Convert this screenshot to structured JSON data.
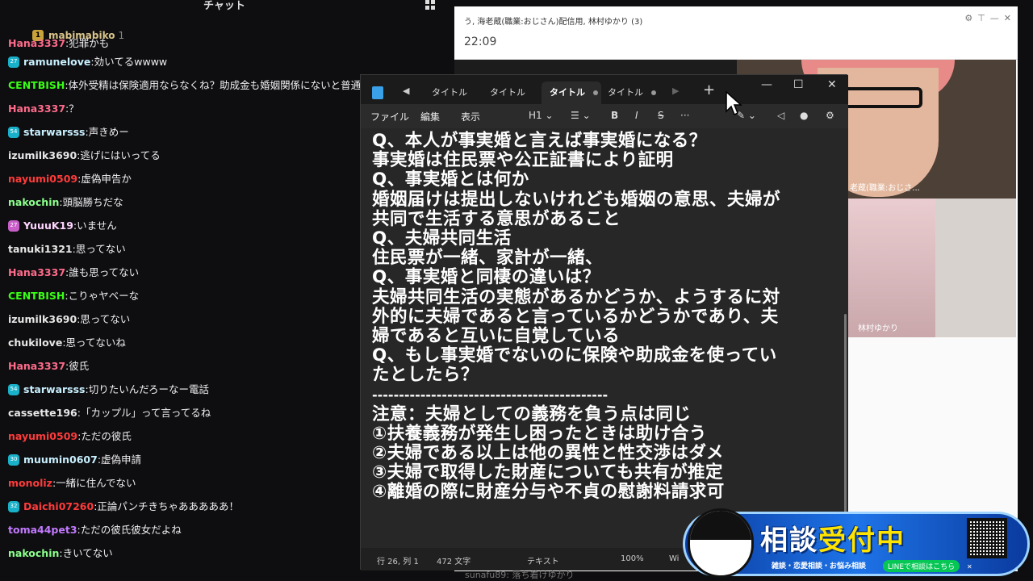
{
  "chat": {
    "title": "チャット",
    "pinned": {
      "badge": "1",
      "name": "mabimabiko",
      "count": "1"
    },
    "messages": [
      {
        "user": "Hana3337",
        "text": "犯罪かも",
        "color": "#ff6b8b",
        "badge": ""
      },
      {
        "user": "ramunelove",
        "text": "効いてるwwww",
        "color": "#c9f0ff",
        "badge": "27",
        "badge_color": "#19b1c9"
      },
      {
        "user": "CENTBISH",
        "text": "体外受精は保険適用ならなくね？助成金も婚姻関係にないと普通",
        "color": "#39ff14",
        "badge": ""
      },
      {
        "user": "Hana3337",
        "text": "？",
        "color": "#ff6b8b",
        "badge": ""
      },
      {
        "user": "starwarsss",
        "text": "声きめー",
        "color": "#c9f0ff",
        "badge": "54",
        "badge_color": "#19b1c9"
      },
      {
        "user": "izumilk3690",
        "text": "逃げにはいってる",
        "color": "#e8e8e8",
        "badge": ""
      },
      {
        "user": "nayumi0509",
        "text": "虚偽申告か",
        "color": "#ff3b3b",
        "badge": ""
      },
      {
        "user": "nakochin",
        "text": "頭脳勝ちだな",
        "color": "#8cff8c",
        "badge": ""
      },
      {
        "user": "YuuuK19",
        "text": "いません",
        "color": "#ffd6ff",
        "badge": "27",
        "badge_color": "#c85fc8"
      },
      {
        "user": "tanuki1321",
        "text": "思ってない",
        "color": "#e8e8e8",
        "badge": ""
      },
      {
        "user": "Hana3337",
        "text": "誰も思ってない",
        "color": "#ff6b8b",
        "badge": ""
      },
      {
        "user": "CENTBISH",
        "text": "こりゃヤベーな",
        "color": "#39ff14",
        "badge": ""
      },
      {
        "user": "izumilk3690",
        "text": "思ってない",
        "color": "#e8e8e8",
        "badge": ""
      },
      {
        "user": "chukilove",
        "text": "思ってないね",
        "color": "#e8e8e8",
        "badge": ""
      },
      {
        "user": "Hana3337",
        "text": "彼氏",
        "color": "#ff6b8b",
        "badge": ""
      },
      {
        "user": "starwarsss",
        "text": "切りたいんだろーなー電話",
        "color": "#c9f0ff",
        "badge": "54",
        "badge_color": "#19b1c9"
      },
      {
        "user": "cassette196",
        "text": "「カップル」って言ってるね",
        "color": "#e8e8e8",
        "badge": ""
      },
      {
        "user": "nayumi0509",
        "text": "ただの彼氏",
        "color": "#ff3b3b",
        "badge": ""
      },
      {
        "user": "muumin0607",
        "text": "虚偽申請",
        "color": "#c9f0ff",
        "badge": "30",
        "badge_color": "#19b1c9"
      },
      {
        "user": "monoliz",
        "text": "一緒に住んでない",
        "color": "#ff3b3b",
        "badge": ""
      },
      {
        "user": "Daichi07260",
        "text": "正論パンチきちゃあああああ！",
        "color": "#ff3b3b",
        "badge": "32",
        "badge_color": "#19b1c9"
      },
      {
        "user": "toma44pet3",
        "text": "ただの彼氏彼女だよね",
        "color": "#c37aff",
        "badge": ""
      },
      {
        "user": "nakochin",
        "text": "きいてない",
        "color": "#8cff8c",
        "badge": ""
      }
    ]
  },
  "call": {
    "title": "う, 海老蔵(職業:おじさん)配信用, 林村ゆかり (3)",
    "time": "22:09",
    "label1": "老蔵(職業:おじさ...",
    "label2": "林村ゆかり"
  },
  "notepad": {
    "tabs": [
      "タイトル",
      "タイトル",
      "タイトル",
      "タイトル"
    ],
    "plus": "+",
    "menu": {
      "file": "ファイル",
      "edit": "編集",
      "view": "表示",
      "heading": "H1"
    },
    "lines": [
      "Q、本人が事実婚と言えば事実婚になる？",
      "事実婚は住民票や公正証書により証明",
      "Q、事実婚とは何か",
      "婚姻届けは提出しないけれども婚姻の意思、夫婦が",
      "共同で生活する意思があること",
      "Q、夫婦共同生活",
      "住民票が一緒、家計が一緒、",
      "Q、事実婚と同棲の違いは？",
      "夫婦共同生活の実態があるかどうか、ようするに対",
      "外的に夫婦であると言っているかどうかであり、夫",
      "婦であると互いに自覚している",
      "Q、もし事実婚でないのに保険や助成金を使ってい",
      "たとしたら？",
      "--------------------------------------------",
      "注意：夫婦としての義務を負う点は同じ",
      "①扶養義務が発生し困ったときは助け合う",
      "②夫婦である以上は他の異性と性交渉はダメ",
      "③夫婦で取得した財産についても共有が推定",
      "④離婚の際に財産分与や不貞の慰謝料請求可"
    ],
    "status": {
      "position": "行 26, 列 1",
      "chars": "472 文字",
      "format": "テキスト",
      "zoom": "100%",
      "encoding": "Wi"
    }
  },
  "banner": {
    "main_a": "相談",
    "main_b": "受付中",
    "sub": "雑談・恋愛相談・お悩み相談",
    "line": "LINEで相談はこちら"
  },
  "bottom_chat": "sunafu89: 落ち着けゆかり",
  "colors": {
    "accent": "#39ff14",
    "banner_blue": "#1e74e8"
  }
}
